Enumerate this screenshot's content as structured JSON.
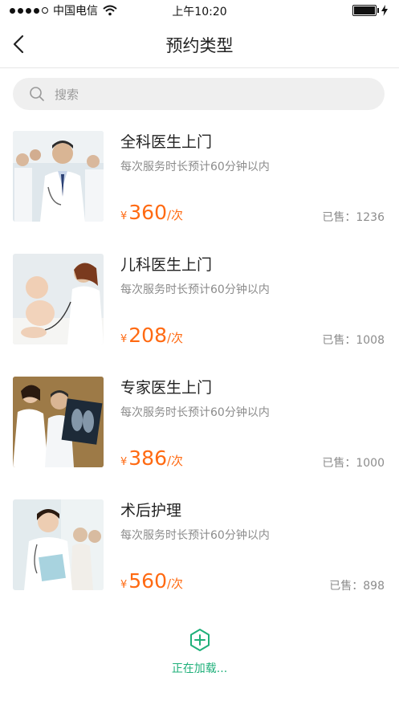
{
  "status_bar": {
    "carrier": "中国电信",
    "time": "上午10:20",
    "icons": [
      "signal-icon",
      "wifi-icon",
      "battery-icon",
      "charging-icon"
    ]
  },
  "nav": {
    "title": "预约类型",
    "back_icon": "chevron-left-icon"
  },
  "search": {
    "placeholder": "搜索",
    "icon": "search-icon"
  },
  "services": [
    {
      "title": "全科医生上门",
      "desc": "每次服务时长预计60分钟以内",
      "currency": "¥",
      "price": "360",
      "unit": "/次",
      "sold": "已售：1236",
      "image": "doctors-team-photo"
    },
    {
      "title": "儿科医生上门",
      "desc": "每次服务时长预计60分钟以内",
      "currency": "¥",
      "price": "208",
      "unit": "/次",
      "sold": "已售：1008",
      "image": "pediatric-checkup-photo"
    },
    {
      "title": "专家医生上门",
      "desc": "每次服务时长预计60分钟以内",
      "currency": "¥",
      "price": "386",
      "unit": "/次",
      "sold": "已售：1000",
      "image": "xray-review-photo"
    },
    {
      "title": "术后护理",
      "desc": "每次服务时长预计60分钟以内",
      "currency": "¥",
      "price": "560",
      "unit": "/次",
      "sold": "已售：898",
      "image": "nurse-care-photo"
    }
  ],
  "loading": {
    "text": "正在加载...",
    "icon": "plus-circle-icon"
  },
  "colors": {
    "price": "#ff6a12",
    "accent_green": "#1fb07a",
    "search_bg": "#efefef",
    "muted_text": "#8c8c8c"
  }
}
